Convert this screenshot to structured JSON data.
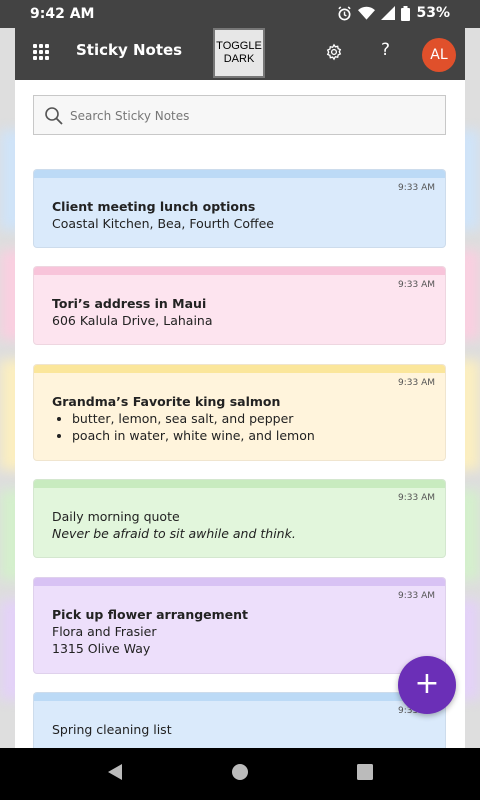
{
  "status_bar": {
    "time": "9:42 AM",
    "battery": "53%"
  },
  "header": {
    "title": "Sticky Notes",
    "toggle_line1": "TOGGLE",
    "toggle_line2": "DARK",
    "help": "?",
    "avatar": "AL"
  },
  "search": {
    "placeholder": "Search Sticky Notes"
  },
  "notes": [
    {
      "color": "#daeafb",
      "accent": "#bcdaf6",
      "time": "9:33 AM",
      "title": "Client meeting lunch options",
      "lines": [
        "Coastal Kitchen, Bea, Fourth Coffee"
      ]
    },
    {
      "color": "#fde4ef",
      "accent": "#f8c4da",
      "time": "9:33 AM",
      "title": "Tori’s address in Maui",
      "lines": [
        "606 Kalula Drive, Lahaina"
      ]
    },
    {
      "color": "#fff4dc",
      "accent": "#fbe69b",
      "time": "9:33 AM",
      "title": "Grandma’s Favorite king salmon",
      "bullets": [
        "butter, lemon, sea salt, and pepper",
        "poach in water, white wine, and lemon"
      ]
    },
    {
      "color": "#e2f6dc",
      "accent": "#c8ebbf",
      "time": "9:33 AM",
      "line": "Daily morning quote",
      "italic": "Never be afraid to sit awhile and think."
    },
    {
      "color": "#eddffb",
      "accent": "#d8c2f4",
      "time": "9:33 AM",
      "title": "Pick up flower arrangement",
      "lines": [
        "Flora and Frasier",
        "1315 Olive Way"
      ]
    },
    {
      "color": "#daeafb",
      "accent": "#bcdaf6",
      "time": "9:33 AM",
      "line": "Spring cleaning list"
    }
  ],
  "fab": {
    "symbol": "+"
  }
}
